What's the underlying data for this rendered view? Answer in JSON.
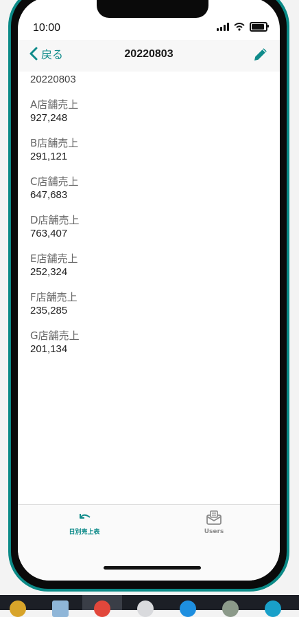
{
  "status_bar": {
    "time": "10:00"
  },
  "navbar": {
    "back_label": "戻る",
    "title": "20220803"
  },
  "record": {
    "date": "20220803",
    "items": [
      {
        "label": "A店舗売上",
        "value": "927,248"
      },
      {
        "label": "B店舗売上",
        "value": "291,121"
      },
      {
        "label": "C店舗売上",
        "value": "647,683"
      },
      {
        "label": "D店舗売上",
        "value": "763,407"
      },
      {
        "label": "E店舗売上",
        "value": "252,324"
      },
      {
        "label": "F店舗売上",
        "value": "235,285"
      },
      {
        "label": "G店舗売上",
        "value": "201,134"
      }
    ]
  },
  "tabs": [
    {
      "label": "日別売上表",
      "icon": "undo-arrow-icon",
      "active": true
    },
    {
      "label": "Users",
      "icon": "mail-inbox-icon",
      "active": false
    }
  ],
  "colors": {
    "accent": "#0f8b8a",
    "phone_frame": "#0b8a87",
    "taskbar": "#1c1f26"
  }
}
